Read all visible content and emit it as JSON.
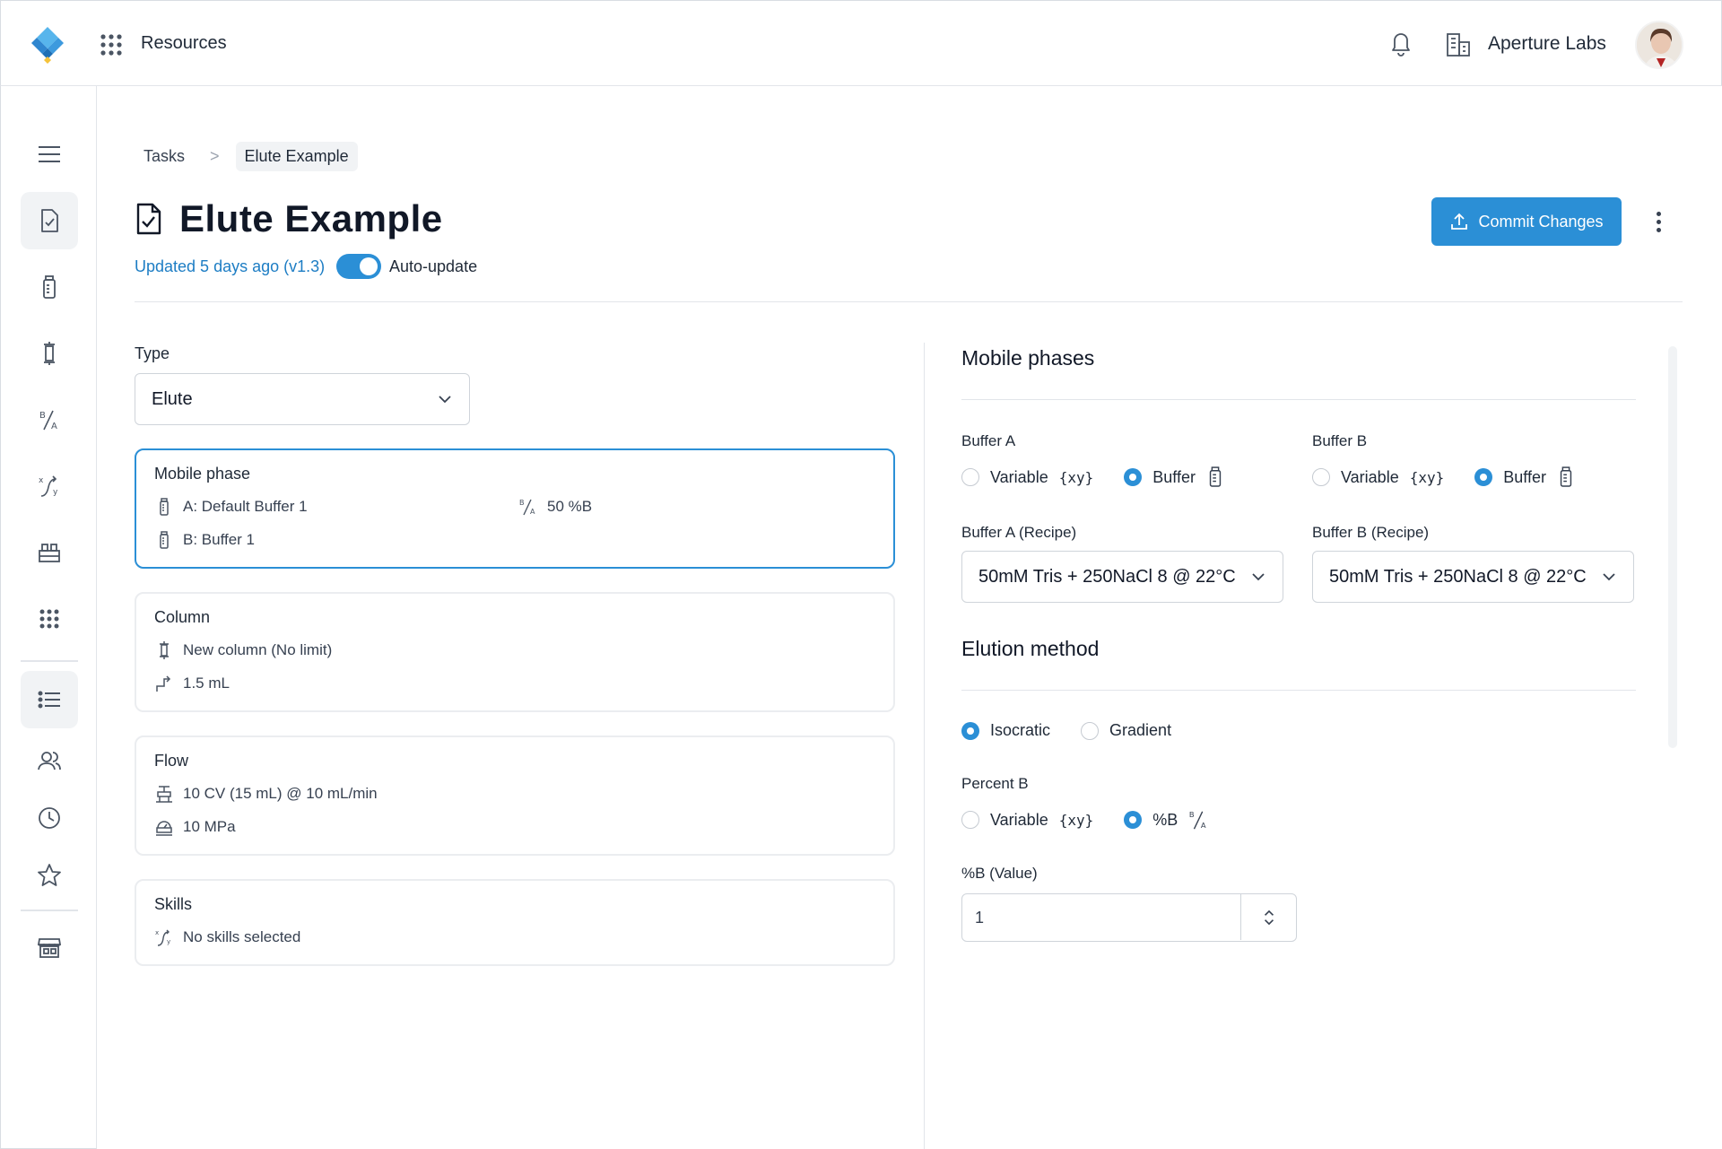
{
  "topbar": {
    "app_menu_label": "Resources",
    "org_name": "Aperture Labs"
  },
  "breadcrumb": {
    "items": [
      "Tasks",
      "Elute Example"
    ],
    "separator": ">"
  },
  "page": {
    "title": "Elute Example",
    "updated": "Updated 5 days ago (v1.3)",
    "auto_update_label": "Auto-update",
    "auto_update_on": true,
    "commit_label": "Commit Changes"
  },
  "left": {
    "type_label": "Type",
    "type_value": "Elute",
    "cards": {
      "mobile_phase": {
        "title": "Mobile phase",
        "buffer_a": "A: Default Buffer 1",
        "buffer_b": "B: Buffer 1",
        "percent_b": "50 %B"
      },
      "column": {
        "title": "Column",
        "name": "New column (No limit)",
        "volume": "1.5 mL"
      },
      "flow": {
        "title": "Flow",
        "rate": "10 CV (15 mL) @ 10 mL/min",
        "pressure": "10 MPa"
      },
      "skills": {
        "title": "Skills",
        "value": "No skills selected"
      }
    }
  },
  "right": {
    "mobile_phases_title": "Mobile phases",
    "buffer_a_label": "Buffer A",
    "buffer_b_label": "Buffer B",
    "variable_label": "Variable",
    "variable_glyph": "{xy}",
    "buffer_label": "Buffer",
    "buffer_a_recipe_label": "Buffer A (Recipe)",
    "buffer_b_recipe_label": "Buffer B (Recipe)",
    "buffer_a_recipe": "50mM Tris + 250NaCl 8 @ 22°C",
    "buffer_b_recipe": "50mM Tris + 250NaCl 8 @ 22°C",
    "elution_title": "Elution method",
    "isocratic_label": "Isocratic",
    "gradient_label": "Gradient",
    "percent_b_label": "Percent B",
    "percent_b_option": "%B",
    "percent_b_value_label": "%B (Value)",
    "percent_b_value": "1"
  },
  "colors": {
    "accent": "#2b8fd6",
    "link": "#1d7dc4",
    "border": "#e2e5ea"
  }
}
